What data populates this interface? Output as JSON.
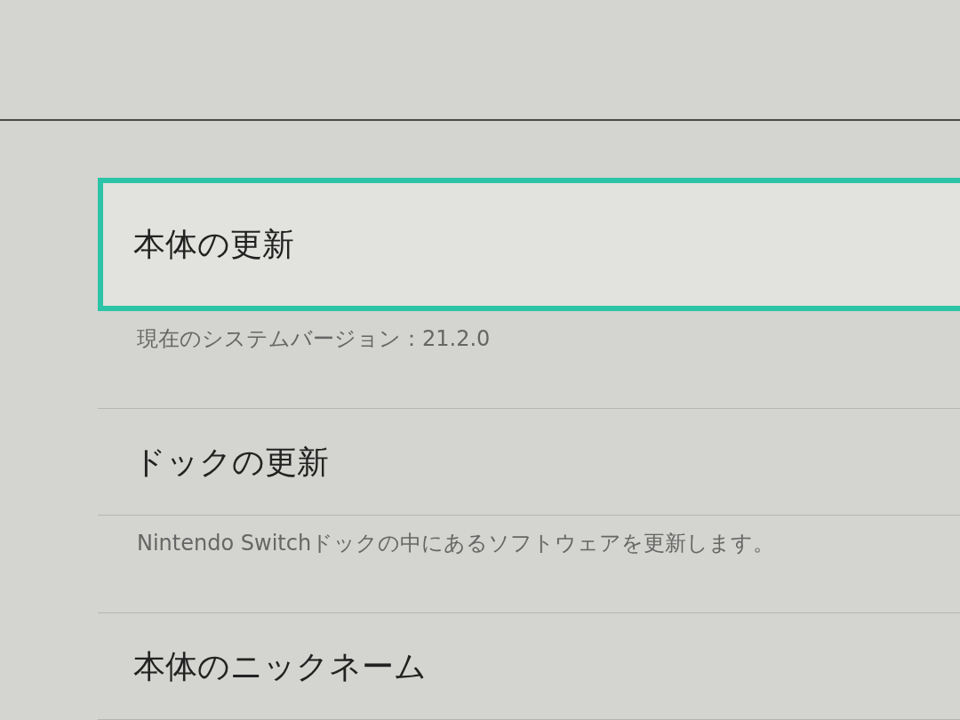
{
  "settings_items": [
    {
      "label": "本体の更新",
      "selected": true,
      "description": "現在のシステムバージョン：21.2.0"
    },
    {
      "label": "ドックの更新",
      "selected": false,
      "description": "Nintendo Switchドックの中にあるソフトウェアを更新します。"
    },
    {
      "label": "本体のニックネーム",
      "selected": false
    }
  ]
}
